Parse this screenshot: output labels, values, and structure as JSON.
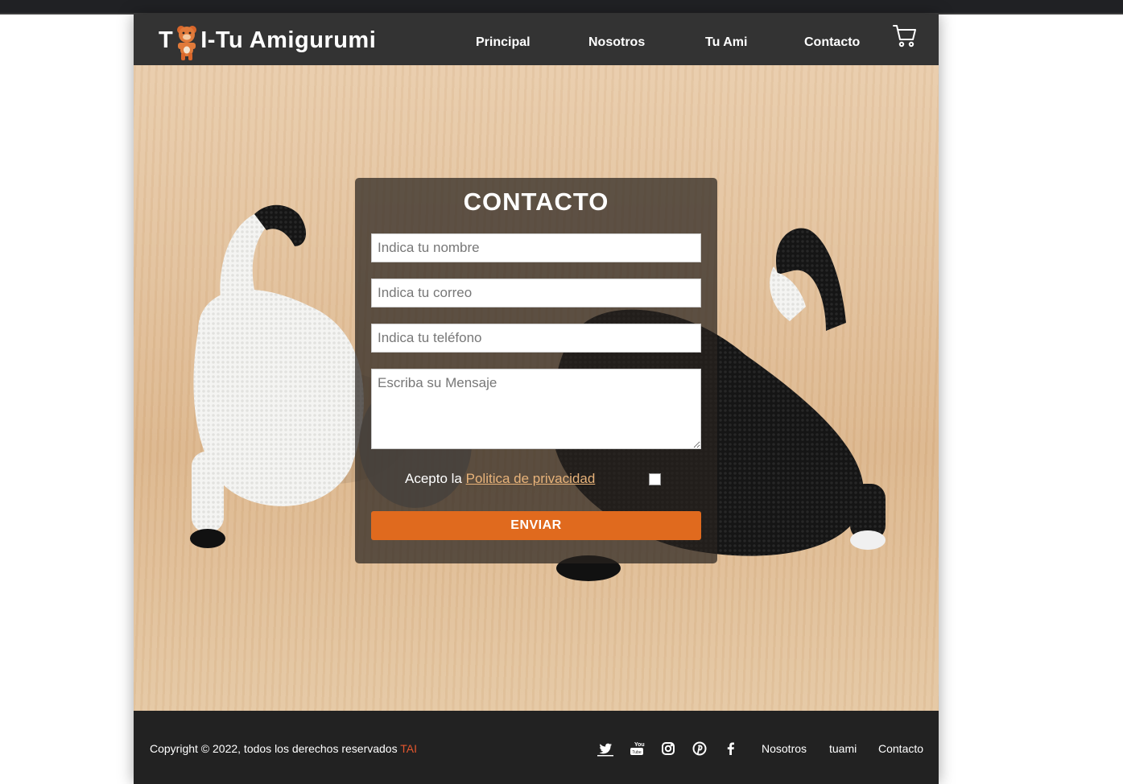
{
  "header": {
    "logo_left": "T",
    "logo_right": "I-Tu Amigurumi",
    "nav": [
      "Principal",
      "Nosotros",
      "Tu Ami",
      "Contacto"
    ]
  },
  "form": {
    "title": "CONTACTO",
    "name_placeholder": "Indica tu nombre",
    "email_placeholder": "Indica tu correo",
    "phone_placeholder": "Indica tu teléfono",
    "message_placeholder": "Escriba su Mensaje",
    "privacy_prefix": "Acepto la",
    "privacy_link": "Politica de privacidad ",
    "privacy_checked": false,
    "submit_label": "ENVIAR"
  },
  "footer": {
    "copyright": "Copyright © 2022, todos los derechos reservados ",
    "brand": "TAI",
    "social_icons": [
      "twitter-icon",
      "youtube-icon",
      "instagram-icon",
      "pinterest-icon",
      "facebook-icon"
    ],
    "links": [
      "Nosotros",
      "tuami",
      "Contacto"
    ]
  },
  "colors": {
    "header_bg": "#333333",
    "accent": "#e06a1e",
    "footer_bg": "#222222",
    "link": "#e8b37a",
    "brand": "#e4572e"
  }
}
